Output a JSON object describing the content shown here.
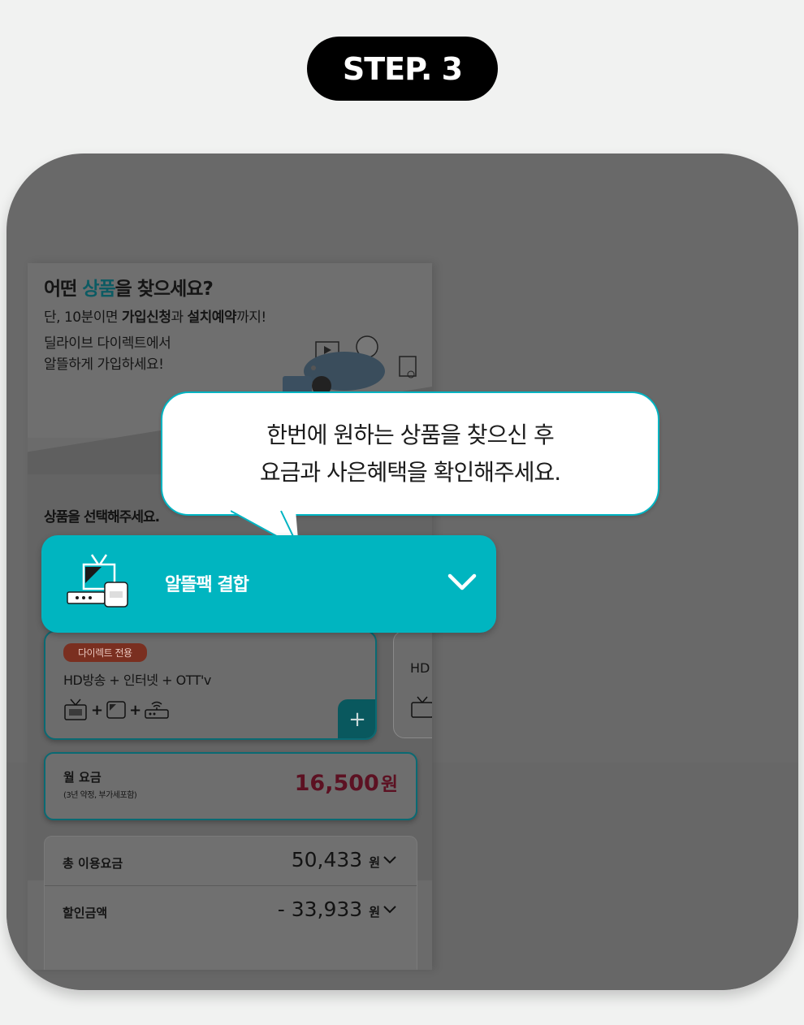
{
  "step": {
    "label": "STEP. 3"
  },
  "hero": {
    "title_pre": "어떤 ",
    "title_accent": "상품",
    "title_post": "을 찾으세요?",
    "line1_pre": "단, 10분이면 ",
    "line1_b1": "가입신청",
    "line1_mid": "과 ",
    "line1_b2": "설치예약",
    "line1_post": "까지!",
    "line2": "딜라이브 다이렉트에서",
    "line3": "알뜰하게 가입하세요!"
  },
  "select_label": "상품을 선택해주세요.",
  "tooltip": {
    "line1": "한번에 원하는 상품을 찾으신 후",
    "line2": "요금과 사은혜택을 확인해주세요."
  },
  "dropdown": {
    "label": "알뜰팩 결합",
    "icon": "tv-bundle-icon"
  },
  "product_card": {
    "badge": "다이렉트 전용",
    "desc": "HD방송 + 인터넷 + OTT'v",
    "plus1": "+",
    "plus2": "+",
    "add_label": "+"
  },
  "product_card2": {
    "desc": "HD"
  },
  "monthly_fee": {
    "label": "월 요금",
    "sub": "(3년 약정, 부가세포함)",
    "amount": "16,500",
    "unit": "원"
  },
  "summary": [
    {
      "label": "총 이용요금",
      "value": "50,433",
      "unit": "원"
    },
    {
      "label": "할인금액",
      "value": "- 33,933",
      "unit": "원"
    }
  ],
  "colors": {
    "accent": "#00b5c0",
    "frame": "#696969",
    "price": "#5c1122"
  }
}
